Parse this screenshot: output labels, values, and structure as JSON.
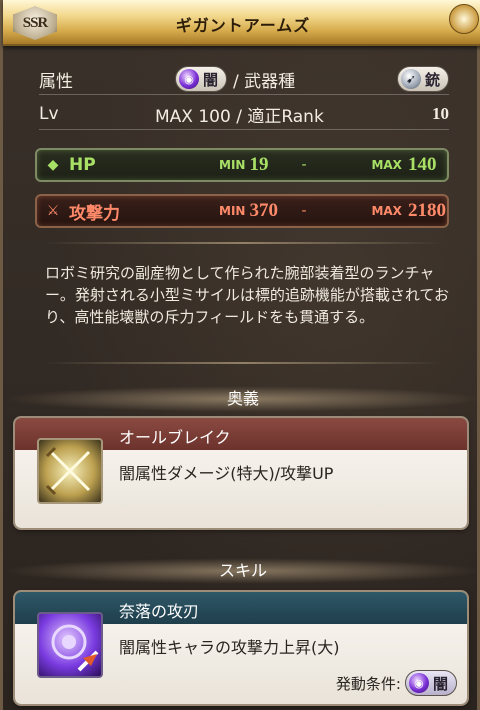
{
  "header": {
    "badge": "SSR",
    "title": "ギガントアームズ"
  },
  "row1": {
    "element_label": "属性",
    "element_value": "闇",
    "weapon_type_label": "/ 武器種",
    "weapon_type_value": "銃"
  },
  "row2": {
    "lv_label": "Lv",
    "lv_value": "MAX 100 / 適正Rank",
    "rank_value": "10"
  },
  "hp": {
    "label": "HP",
    "min_label": "MIN",
    "min": "19",
    "dash": "-",
    "max_label": "MAX",
    "max": "140"
  },
  "atk": {
    "label": "攻撃力",
    "min_label": "MIN",
    "min": "370",
    "dash": "-",
    "max_label": "MAX",
    "max": "2180"
  },
  "description": "ロボミ研究の副産物として作られた腕部装着型のランチャー。発射される小型ミサイルは標的追跡機能が搭載されており、高性能壊獣の斥力フィールドをも貫通する。",
  "ougi": {
    "section_label": "奥義",
    "name": "オールブレイク",
    "effect": "闇属性ダメージ(特大)/攻撃UP",
    "icon": "crossed-swords-icon"
  },
  "skill": {
    "section_label": "スキル",
    "name": "奈落の攻刃",
    "effect": "闇属性キャラの攻撃力上昇(大)",
    "condition_label": "発動条件:",
    "condition_value": "闇",
    "icon": "dark-attack-skill-icon"
  },
  "colors": {
    "header_gold": "#d6ab4c",
    "hp_green": "#a8e066",
    "atk_red": "#ff8a6a",
    "ougi_band": "#8a4a42",
    "skill_band": "#2f5868",
    "dark_element": "#7a2fd6"
  }
}
